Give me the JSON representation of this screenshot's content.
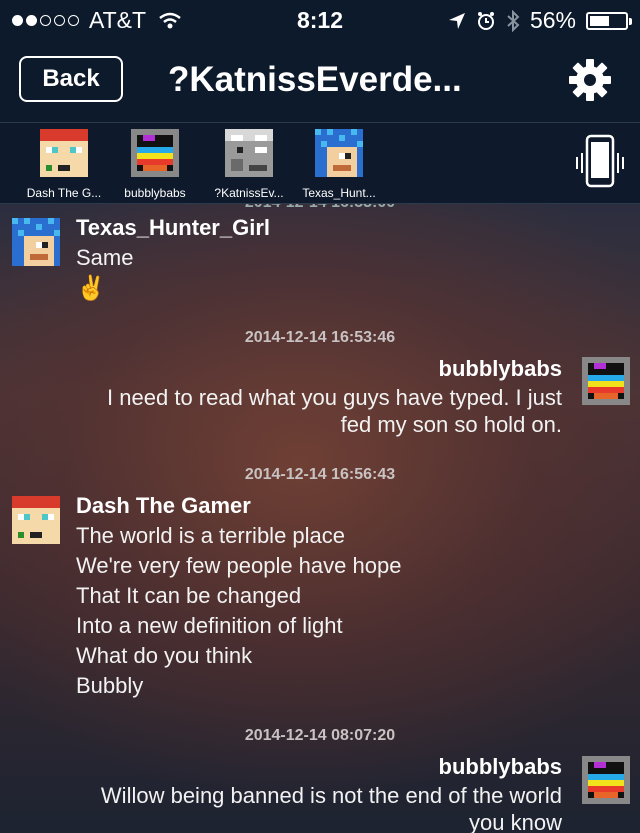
{
  "status_bar": {
    "carrier": "AT&T",
    "time": "8:12",
    "battery": "56%",
    "battery_level": 0.56,
    "signal_bars_filled": 2,
    "signal_bars_total": 5
  },
  "nav": {
    "back_label": "Back",
    "title": "?KatnissEverde..."
  },
  "participants": [
    {
      "name": "Dash The G...",
      "avatar": "red-hat-avatar-icon"
    },
    {
      "name": "bubblybabs",
      "avatar": "rainbow-avatar-icon"
    },
    {
      "name": "?KatnissEv...",
      "avatar": "grey-avatar-icon"
    },
    {
      "name": "Texas_Hunt...",
      "avatar": "blue-avatar-icon"
    }
  ],
  "messages": [
    {
      "sender": "Texas_Hunter_Girl",
      "side": "left",
      "lines": [
        "Same",
        "✌"
      ]
    },
    {
      "timestamp": "2014-12-14 16:53:46",
      "sender": "bubblybabs",
      "side": "right",
      "lines": [
        "I need to read what you guys have typed.  I just",
        "fed my son so hold on."
      ]
    },
    {
      "timestamp": "2014-12-14 16:56:43",
      "sender": "Dash The Gamer",
      "side": "left",
      "lines": [
        "The world is a terrible place",
        "We're very few people have hope",
        "That It can be changed",
        "Into a new definition of light",
        "What do you think",
        "Bubbly"
      ]
    },
    {
      "timestamp": "2014-12-14 08:07:20",
      "sender": "bubblybabs",
      "side": "right",
      "lines": [
        "Willow being banned is not the end of the world",
        "you know"
      ]
    }
  ],
  "colors": {
    "bar_bg": "#0d1a2b",
    "text": "#ffffff",
    "timestamp": "#c8c2c2"
  }
}
